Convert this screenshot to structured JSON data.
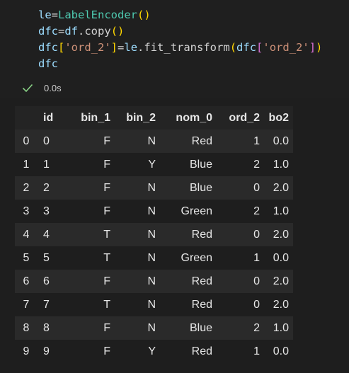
{
  "cell": {
    "code_lines": [
      [
        {
          "t": "le",
          "c": "var"
        },
        {
          "t": "=",
          "c": "op"
        },
        {
          "t": "LabelEncoder",
          "c": "fn"
        },
        {
          "t": "()",
          "c": "br2"
        }
      ],
      [
        {
          "t": "dfc",
          "c": "var"
        },
        {
          "t": "=",
          "c": "op"
        },
        {
          "t": "df",
          "c": "var"
        },
        {
          "t": ".copy",
          "c": "op"
        },
        {
          "t": "()",
          "c": "br2"
        }
      ],
      [
        {
          "t": "dfc",
          "c": "var"
        },
        {
          "t": "[",
          "c": "br2"
        },
        {
          "t": "'ord_2'",
          "c": "str"
        },
        {
          "t": "]",
          "c": "br2"
        },
        {
          "t": "=",
          "c": "op"
        },
        {
          "t": "le",
          "c": "var"
        },
        {
          "t": ".fit_transform",
          "c": "op"
        },
        {
          "t": "(",
          "c": "br2"
        },
        {
          "t": "dfc",
          "c": "var"
        },
        {
          "t": "[",
          "c": "br1"
        },
        {
          "t": "'ord_2'",
          "c": "str"
        },
        {
          "t": "]",
          "c": "br1"
        },
        {
          "t": ")",
          "c": "br2"
        }
      ],
      [
        {
          "t": "dfc",
          "c": "var"
        }
      ]
    ],
    "exec_time": "0.0s",
    "status_icon": "check-icon"
  },
  "table": {
    "columns": [
      "",
      "id",
      "bin_1",
      "bin_2",
      "nom_0",
      "ord_2",
      "bo2"
    ],
    "rows": [
      [
        "0",
        "0",
        "F",
        "N",
        "Red",
        "1",
        "0.0"
      ],
      [
        "1",
        "1",
        "F",
        "Y",
        "Blue",
        "2",
        "1.0"
      ],
      [
        "2",
        "2",
        "F",
        "N",
        "Blue",
        "0",
        "2.0"
      ],
      [
        "3",
        "3",
        "F",
        "N",
        "Green",
        "2",
        "1.0"
      ],
      [
        "4",
        "4",
        "T",
        "N",
        "Red",
        "0",
        "2.0"
      ],
      [
        "5",
        "5",
        "T",
        "N",
        "Green",
        "1",
        "0.0"
      ],
      [
        "6",
        "6",
        "F",
        "N",
        "Red",
        "0",
        "2.0"
      ],
      [
        "7",
        "7",
        "T",
        "N",
        "Red",
        "0",
        "2.0"
      ],
      [
        "8",
        "8",
        "F",
        "N",
        "Blue",
        "2",
        "1.0"
      ],
      [
        "9",
        "9",
        "F",
        "Y",
        "Red",
        "1",
        "0.0"
      ]
    ]
  },
  "colors": {
    "background": "#1e1e1e",
    "check": "#89d185"
  }
}
